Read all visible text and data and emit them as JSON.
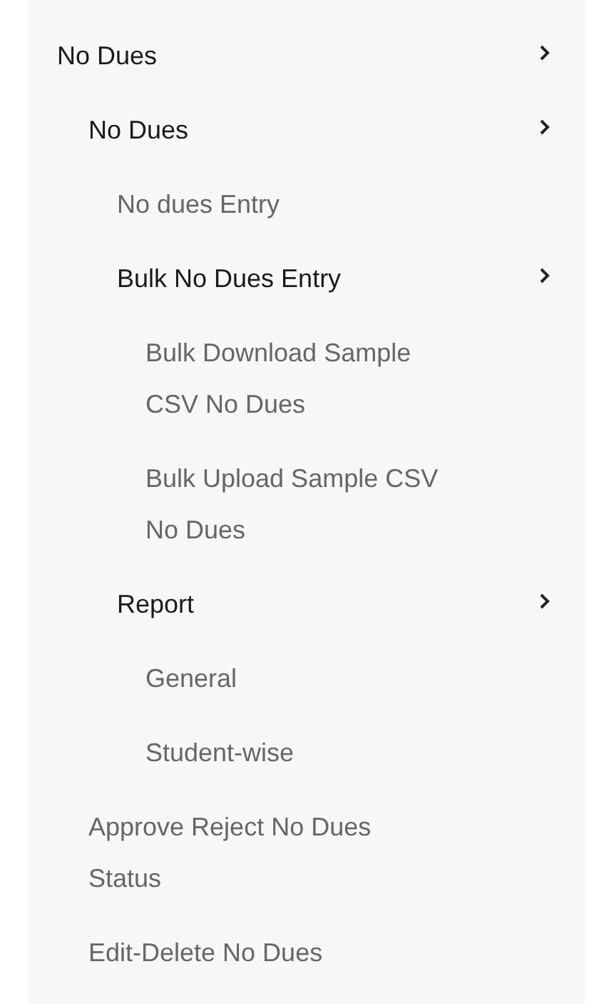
{
  "menu": [
    {
      "label": "No Dues",
      "children": [
        {
          "label": "No Dues",
          "children": [
            {
              "label": "No dues Entry"
            },
            {
              "label": "Bulk No Dues Entry",
              "children": [
                {
                  "label": "Bulk Download Sample CSV No Dues"
                },
                {
                  "label": "Bulk Upload Sample CSV No Dues"
                }
              ]
            },
            {
              "label": "Report",
              "children": [
                {
                  "label": "General"
                },
                {
                  "label": "Student-wise"
                }
              ]
            }
          ]
        },
        {
          "label": "Approve Reject No Dues Status"
        },
        {
          "label": "Edit-Delete No Dues"
        }
      ]
    }
  ]
}
